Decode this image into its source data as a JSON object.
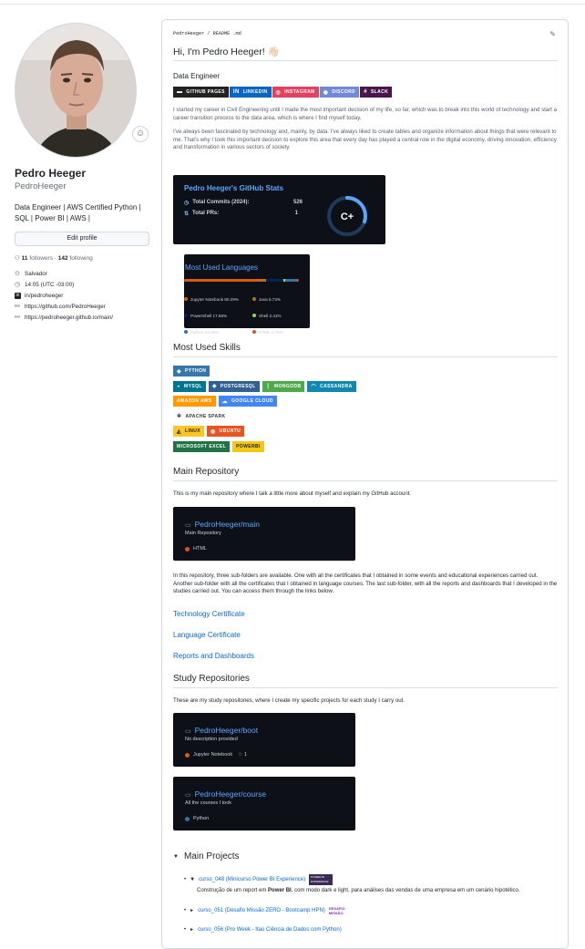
{
  "profile": {
    "name": "Pedro Heeger",
    "login": "PedroHeeger",
    "bio": "Data Engineer | AWS Certified Python | SQL | Power BI | AWS |",
    "edit_label": "Edit profile",
    "followers": "11",
    "followers_label": "followers",
    "following": "142",
    "following_label": "following",
    "location": "Salvador",
    "time": "14:05 (UTC -03:00)",
    "linkedin": "in/pedroheeger",
    "link1": "https://github.com/PedroHeeger",
    "link2": "https://pedroheeger.github.io/main/"
  },
  "readme": {
    "path": "PedroHeeger / README .md",
    "greeting": "Hi, I'm Pedro Heeger! 👋🏻",
    "role": "Data Engineer",
    "contact_badges": [
      {
        "label": "GITHUB PAGES",
        "color": "#222222",
        "icon": "github-pages-icon",
        "glyph": "▬"
      },
      {
        "label": "LINKEDIN",
        "color": "#0a66c2",
        "icon": "linkedin-icon",
        "glyph": "in"
      },
      {
        "label": "INSTAGRAM",
        "color": "#e4405f",
        "icon": "instagram-icon",
        "glyph": "◎"
      },
      {
        "label": "DISCORD",
        "color": "#7289da",
        "icon": "discord-icon",
        "glyph": "◉"
      },
      {
        "label": "SLACK",
        "color": "#4a154b",
        "icon": "slack-icon",
        "glyph": "#"
      }
    ],
    "intro_p1": "I started my career in Civil Engineering until I made the most important decision of my life, so far, which was to break into this world of technology and start a career transition process to the data area, which is where I find myself today.",
    "intro_p2": "I've always been fascinated by technology and, mainly, by data. I've always liked to create tables and organize information about things that were relevant to me. That's why I took this important decision to explore this area that every day has played a central role in the digital economy, driving innovation, efficiency and transformation in various sectors of society.",
    "stats": {
      "title": "Pedro Heeger's GitHub Stats",
      "commits_label": "Total Commits (2024):",
      "commits_value": "526",
      "prs_label": "Total PRs:",
      "prs_value": "1",
      "grade": "C+",
      "grade_progress": 0.3
    },
    "langs": {
      "title": "Most Used Languages",
      "items": [
        {
          "name": "Jupyter Notebook",
          "pct": "80.29%",
          "value": 80.29,
          "color": "#da5b0b"
        },
        {
          "name": "Java",
          "pct": "5.73%",
          "value": 5.73,
          "color": "#b07219"
        },
        {
          "name": "PowerShell",
          "pct": "17.56%",
          "value": 17.56,
          "color": "#012456"
        },
        {
          "name": "Shell",
          "pct": "2.41%",
          "value": 2.41,
          "color": "#89e051"
        },
        {
          "name": "Python",
          "pct": "12.28%",
          "value": 12.28,
          "color": "#3572a5"
        },
        {
          "name": "HTML",
          "pct": "1.74%",
          "value": 1.74,
          "color": "#e34c26"
        }
      ]
    },
    "skills_heading": "Most Used Skills",
    "skill_rows": [
      [
        {
          "label": "PYTHON",
          "color": "#3776ab",
          "glyph": "◆",
          "icon": "python-icon"
        }
      ],
      [
        {
          "label": "MYSQL",
          "color": "#00758f",
          "glyph": "◒",
          "icon": "mysql-icon"
        },
        {
          "label": "POSTGRESQL",
          "color": "#316192",
          "glyph": "◈",
          "icon": "postgresql-icon"
        },
        {
          "label": "MONGODB",
          "color": "#4ea94b",
          "glyph": "❘",
          "icon": "mongodb-icon"
        },
        {
          "label": "CASSANDRA",
          "color": "#1287b1",
          "glyph": "◠",
          "icon": "cassandra-icon"
        }
      ],
      [
        {
          "label": "AMAZON AWS",
          "color": "#ff9900",
          "glyph": "",
          "icon": "aws-icon"
        },
        {
          "label": "GOOGLE CLOUD",
          "color": "#4285f4",
          "glyph": "☁",
          "icon": "google-cloud-icon"
        }
      ],
      [
        {
          "label": "APACHE SPARK",
          "color": "#ffffff",
          "glyph": "✲",
          "icon": "spark-icon",
          "text": "#333333"
        }
      ],
      [
        {
          "label": "LINUX",
          "color": "#fcc624",
          "glyph": "◭",
          "icon": "linux-icon",
          "text": "#222222"
        },
        {
          "label": "UBUNTU",
          "color": "#e95420",
          "glyph": "◍",
          "icon": "ubuntu-icon"
        }
      ],
      [
        {
          "label": "MICROSOFT EXCEL",
          "color": "#217346",
          "glyph": "",
          "icon": "excel-icon"
        },
        {
          "label": "POWERBI",
          "color": "#f2c811",
          "glyph": "",
          "icon": "powerbi-icon",
          "text": "#222222"
        }
      ]
    ],
    "main_repo_heading": "Main Repository",
    "main_repo_desc": "This is my main repository where I talk a little more about myself and explain my GitHub account.",
    "main_repo": {
      "title": "PedroHeeger/main",
      "desc": "Main Repository",
      "lang": "HTML",
      "lang_color": "#e34c26"
    },
    "main_repo_p": "In this repository, three sub-folders are available. One with all the certificates that I obtained in some events and educational experiences carried out. Another sub-folder with all the certificates that I obtained in language courses. The last sub-folder, with all the reports and dashboards that I developed in the studies carried out. You can access them through the links below.",
    "links": [
      "Technology Certificate",
      "Language Certificate",
      "Reports and Dashboards"
    ],
    "study_heading": "Study Repositories",
    "study_desc": "These are my study repositories, where I create my specific projects for each study I carry out.",
    "boot_repo": {
      "title": "PedroHeeger/boot",
      "desc": "No description provided",
      "lang": "Jupyter Notebook",
      "lang_color": "#da5b0b",
      "stars": "1"
    },
    "course_repo": {
      "title": "PedroHeeger/course",
      "desc": "All the courses I took",
      "lang": "Python",
      "lang_color": "#3572a5"
    },
    "projects_heading": "Main Projects",
    "projects": [
      {
        "marker": "▼",
        "link": "curso_048 (Minicurso Power BI Experience)",
        "badge": "POWER BI EXPERIENCE",
        "desc_pre": "Construção de um report em ",
        "desc_bold": "Power BI",
        "desc_post": ", com modo dark e light, para análises das vendas de uma empresa em um cenário hipotético."
      },
      {
        "marker": "►",
        "link": "curso_051 (Desafio Missão ZERO - Bootcamp HPN)",
        "badge": "DESAFIO MISSÃO"
      },
      {
        "marker": "►",
        "link": "curso_056 (Pro Week - Itaú Ciência de Dados com Python)"
      }
    ]
  }
}
